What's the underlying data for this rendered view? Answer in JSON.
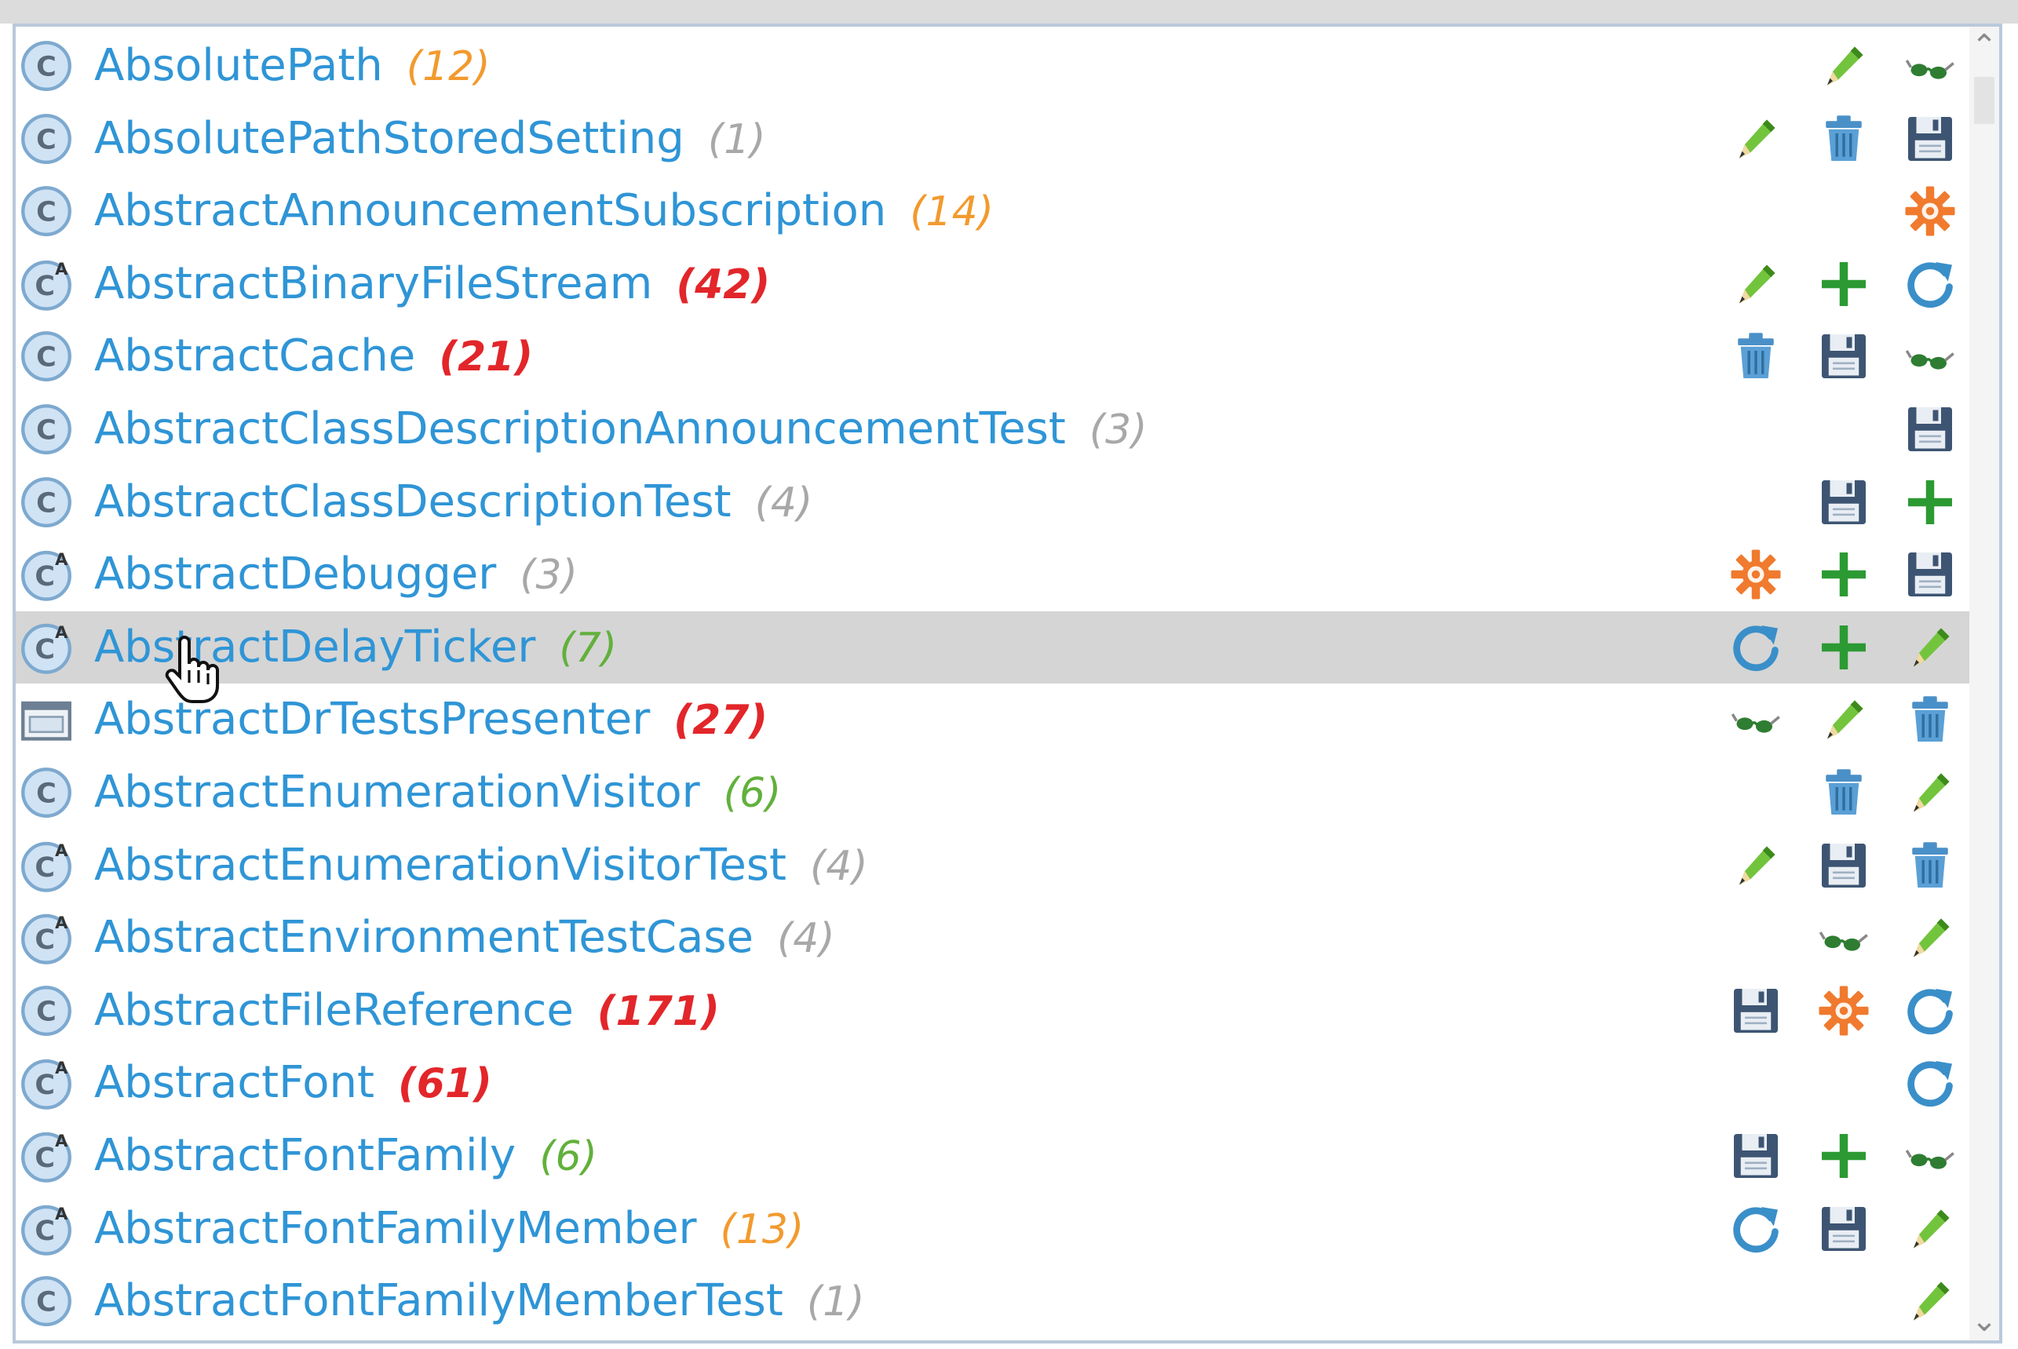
{
  "scrollbar": {
    "up_arrow": "⌃",
    "down_arrow": "⌄"
  },
  "colors": {
    "name": "#2f95d6",
    "orange": "#f29a2e",
    "red": "#e2262a",
    "gray": "#a8a8a8",
    "green": "#62b03c",
    "selected_row": "#d5d5d5"
  },
  "rows": [
    {
      "name": "AbsolutePath",
      "count": "(12)",
      "count_color": "orange",
      "class_icon": "class-icon",
      "actions": [
        "",
        "edit-pencil-icon",
        "glasses-icon"
      ]
    },
    {
      "name": "AbsolutePathStoredSetting",
      "count": "(1)",
      "count_color": "gray",
      "class_icon": "class-icon",
      "actions": [
        "edit-pencil-icon",
        "trash-icon",
        "save-icon"
      ]
    },
    {
      "name": "AbstractAnnouncementSubscription",
      "count": "(14)",
      "count_color": "orange",
      "class_icon": "class-icon",
      "actions": [
        "",
        "",
        "gear-icon"
      ]
    },
    {
      "name": "AbstractBinaryFileStream",
      "count": "(42)",
      "count_color": "red",
      "class_icon": "abstract-class-icon",
      "actions": [
        "edit-pencil-icon",
        "add-icon",
        "refresh-icon"
      ]
    },
    {
      "name": "AbstractCache",
      "count": "(21)",
      "count_color": "red",
      "class_icon": "class-icon",
      "actions": [
        "trash-icon",
        "save-icon",
        "glasses-icon"
      ]
    },
    {
      "name": "AbstractClassDescriptionAnnouncementTest",
      "count": "(3)",
      "count_color": "gray",
      "class_icon": "class-icon",
      "actions": [
        "",
        "",
        "save-icon"
      ]
    },
    {
      "name": "AbstractClassDescriptionTest",
      "count": "(4)",
      "count_color": "gray",
      "class_icon": "class-icon",
      "actions": [
        "",
        "save-icon",
        "add-icon"
      ]
    },
    {
      "name": "AbstractDebugger",
      "count": "(3)",
      "count_color": "gray",
      "class_icon": "abstract-class-icon",
      "actions": [
        "gear-icon",
        "add-icon",
        "save-icon"
      ]
    },
    {
      "name": "AbstractDelayTicker",
      "count": "(7)",
      "count_color": "green",
      "class_icon": "abstract-class-icon",
      "actions": [
        "refresh-icon",
        "add-icon",
        "edit-pencil-icon"
      ],
      "selected": true
    },
    {
      "name": "AbstractDrTestsPresenter",
      "count": "(27)",
      "count_color": "red",
      "class_icon": "presenter-window-icon",
      "actions": [
        "glasses-icon",
        "edit-pencil-icon",
        "trash-icon"
      ]
    },
    {
      "name": "AbstractEnumerationVisitor",
      "count": "(6)",
      "count_color": "green",
      "class_icon": "class-icon",
      "actions": [
        "",
        "trash-icon",
        "edit-pencil-icon"
      ]
    },
    {
      "name": "AbstractEnumerationVisitorTest",
      "count": "(4)",
      "count_color": "gray",
      "class_icon": "abstract-class-icon",
      "actions": [
        "edit-pencil-icon",
        "save-icon",
        "trash-icon"
      ]
    },
    {
      "name": "AbstractEnvironmentTestCase",
      "count": "(4)",
      "count_color": "gray",
      "class_icon": "abstract-class-icon",
      "actions": [
        "",
        "glasses-icon",
        "edit-pencil-icon"
      ]
    },
    {
      "name": "AbstractFileReference",
      "count": "(171)",
      "count_color": "red",
      "class_icon": "class-icon",
      "actions": [
        "save-icon",
        "gear-icon",
        "refresh-icon"
      ]
    },
    {
      "name": "AbstractFont",
      "count": "(61)",
      "count_color": "red",
      "class_icon": "abstract-class-icon",
      "actions": [
        "",
        "",
        "refresh-icon"
      ]
    },
    {
      "name": "AbstractFontFamily",
      "count": "(6)",
      "count_color": "green",
      "class_icon": "abstract-class-icon",
      "actions": [
        "save-icon",
        "add-icon",
        "glasses-icon"
      ]
    },
    {
      "name": "AbstractFontFamilyMember",
      "count": "(13)",
      "count_color": "orange",
      "class_icon": "abstract-class-icon",
      "actions": [
        "refresh-icon",
        "save-icon",
        "edit-pencil-icon"
      ]
    },
    {
      "name": "AbstractFontFamilyMemberTest",
      "count": "(1)",
      "count_color": "gray",
      "class_icon": "class-icon",
      "actions": [
        "",
        "",
        "edit-pencil-icon"
      ]
    }
  ]
}
